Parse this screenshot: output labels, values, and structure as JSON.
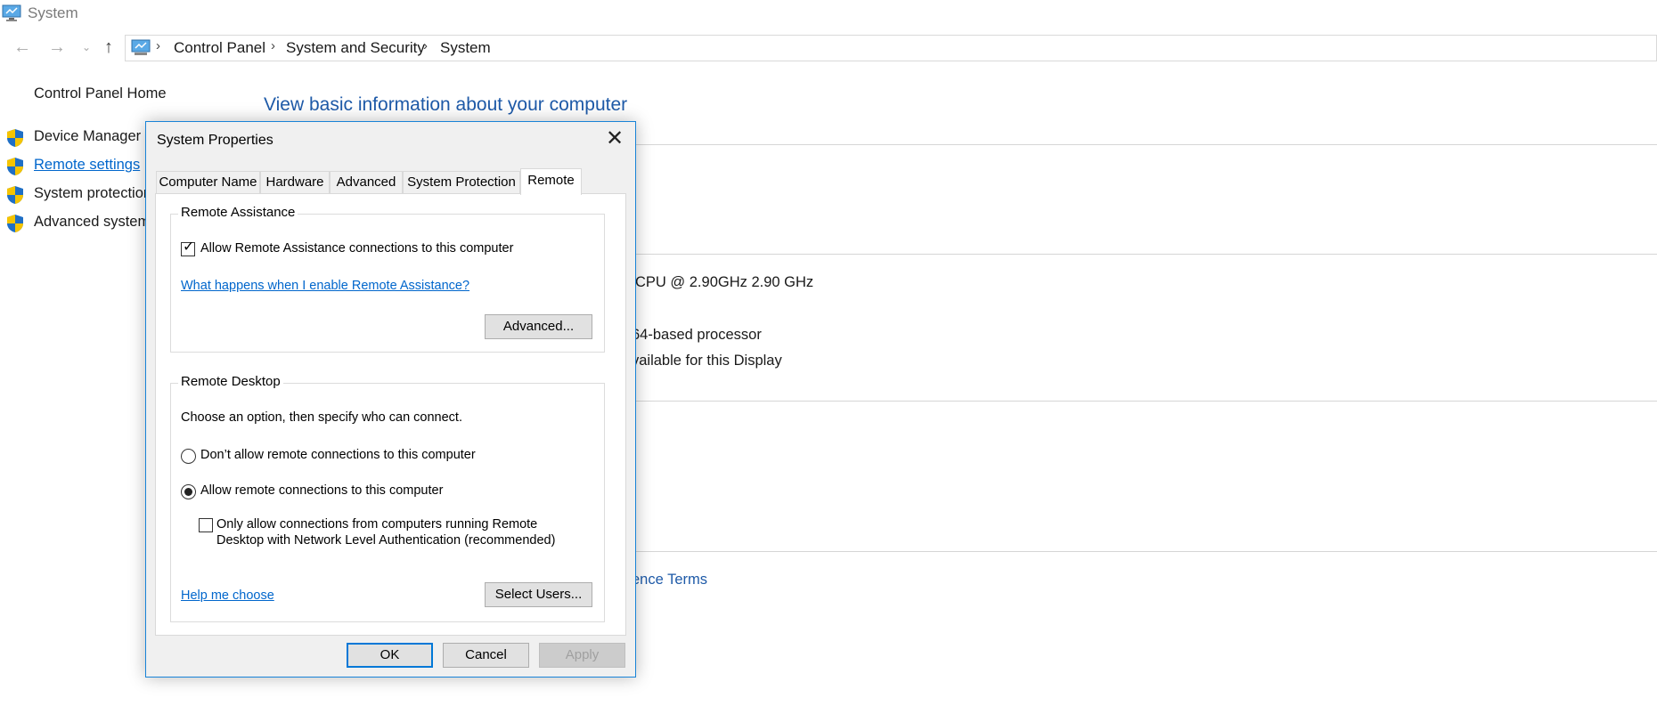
{
  "window": {
    "title": "System"
  },
  "address": {
    "crumbs": [
      "Control Panel",
      "System and Security",
      "System"
    ]
  },
  "left_nav": {
    "home": "Control Panel Home",
    "items": [
      {
        "label": "Device Manager",
        "icon": "shield-icon",
        "link": false
      },
      {
        "label": "Remote settings",
        "icon": "shield-icon",
        "link": true
      },
      {
        "label": "System protection",
        "icon": "shield-icon",
        "link": false
      },
      {
        "label": "Advanced system",
        "icon": "shield-icon",
        "link": false
      }
    ]
  },
  "main": {
    "heading": "View basic information about your computer",
    "processor": "CPU @ 2.90GHz   2.90 GHz",
    "system_type": "64-based processor",
    "pen_touch": "vailable for this Display",
    "license_link": "ence Terms"
  },
  "dialog": {
    "title": "System Properties",
    "close_glyph": "✕",
    "tabs": [
      "Computer Name",
      "Hardware",
      "Advanced",
      "System Protection",
      "Remote"
    ],
    "active_tab": "Remote",
    "remote_assistance": {
      "group_title": "Remote Assistance",
      "allow_label": "Allow Remote Assistance connections to this computer",
      "allow_checked": true,
      "help_link": "What happens when I enable Remote Assistance?",
      "advanced_button": "Advanced..."
    },
    "remote_desktop": {
      "group_title": "Remote Desktop",
      "instruction": "Choose an option, then specify who can connect.",
      "option_dont_allow": "Don’t allow remote connections to this computer",
      "option_allow": "Allow remote connections to this computer",
      "selected_option": "allow",
      "nla_line1": "Only allow connections from computers running Remote",
      "nla_line2": "Desktop with Network Level Authentication (recommended)",
      "nla_checked": false,
      "help_link": "Help me choose",
      "select_users_button": "Select Users..."
    },
    "buttons": {
      "ok": "OK",
      "cancel": "Cancel",
      "apply": "Apply"
    }
  },
  "colors": {
    "link": "#0066cc",
    "heading": "#1e5aa8",
    "dialog_border": "#1883d7",
    "shield_blue": "#1f6fc5",
    "shield_yellow": "#f5c400"
  }
}
